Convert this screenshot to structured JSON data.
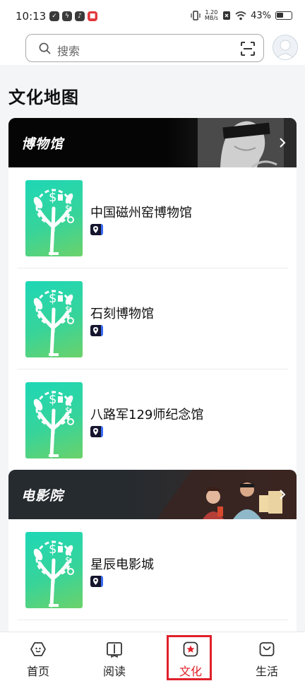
{
  "status_bar": {
    "time": "10:13",
    "net_speed_value": "1.20",
    "net_speed_unit": "MB/s",
    "battery": "43%"
  },
  "search": {
    "placeholder": "搜索"
  },
  "page_title": "文化地图",
  "sections": [
    {
      "title": "博物馆",
      "items": [
        {
          "name": "中国磁州窑博物馆"
        },
        {
          "name": "石刻博物馆"
        },
        {
          "name": "八路军129师纪念馆"
        }
      ]
    },
    {
      "title": "电影院",
      "items": [
        {
          "name": "星辰电影城"
        }
      ]
    }
  ],
  "bottom_nav": {
    "items": [
      {
        "label": "首页",
        "icon": "home-icon"
      },
      {
        "label": "阅读",
        "icon": "book-icon"
      },
      {
        "label": "文化",
        "icon": "star-icon",
        "active": true
      },
      {
        "label": "生活",
        "icon": "bag-icon"
      }
    ],
    "active_color": "#e0202a"
  },
  "colors": {
    "thumb_gradient_start": "#1ed7b6",
    "thumb_gradient_end": "#6bd26a",
    "location_badge": "#15152e"
  }
}
